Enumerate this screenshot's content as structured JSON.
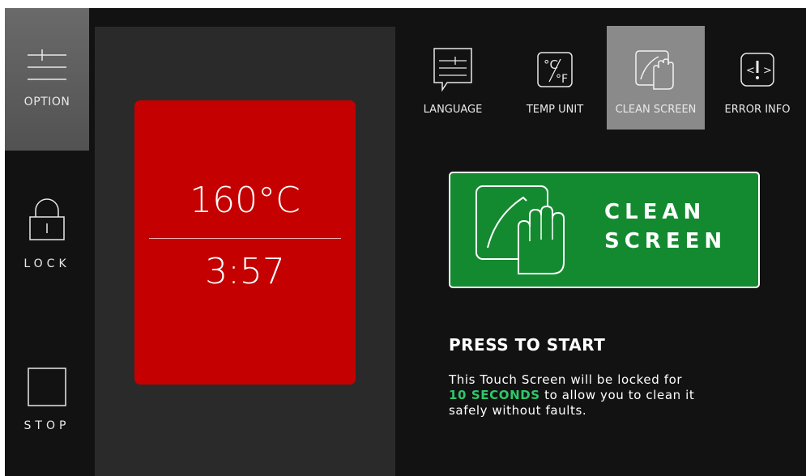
{
  "sidebar": {
    "option_label": "OPTION",
    "lock_label": "LOCK",
    "stop_label": "STOP"
  },
  "display": {
    "temperature": "160°C",
    "time": "3:57"
  },
  "menu": {
    "items": [
      {
        "label": "LANGUAGE",
        "icon": "language-icon"
      },
      {
        "label": "TEMP UNIT",
        "icon": "temp-unit-icon"
      },
      {
        "label": "CLEAN SCREEN",
        "icon": "clean-screen-icon",
        "active": true
      },
      {
        "label": "ERROR INFO",
        "icon": "error-info-icon"
      }
    ]
  },
  "clean_button": {
    "line1": "CLEAN",
    "line2": "SCREEN"
  },
  "instructions": {
    "title": "PRESS TO START",
    "text_before": "This Touch Screen will be locked for",
    "highlight": "10 SECONDS",
    "text_after": " to allow you to clean it",
    "text_line3": "safely without faults."
  },
  "colors": {
    "background": "#121212",
    "display_red": "#c40000",
    "clean_green": "#148a30",
    "highlight_green": "#2ec76a",
    "active_menu": "#8a8a8a"
  }
}
